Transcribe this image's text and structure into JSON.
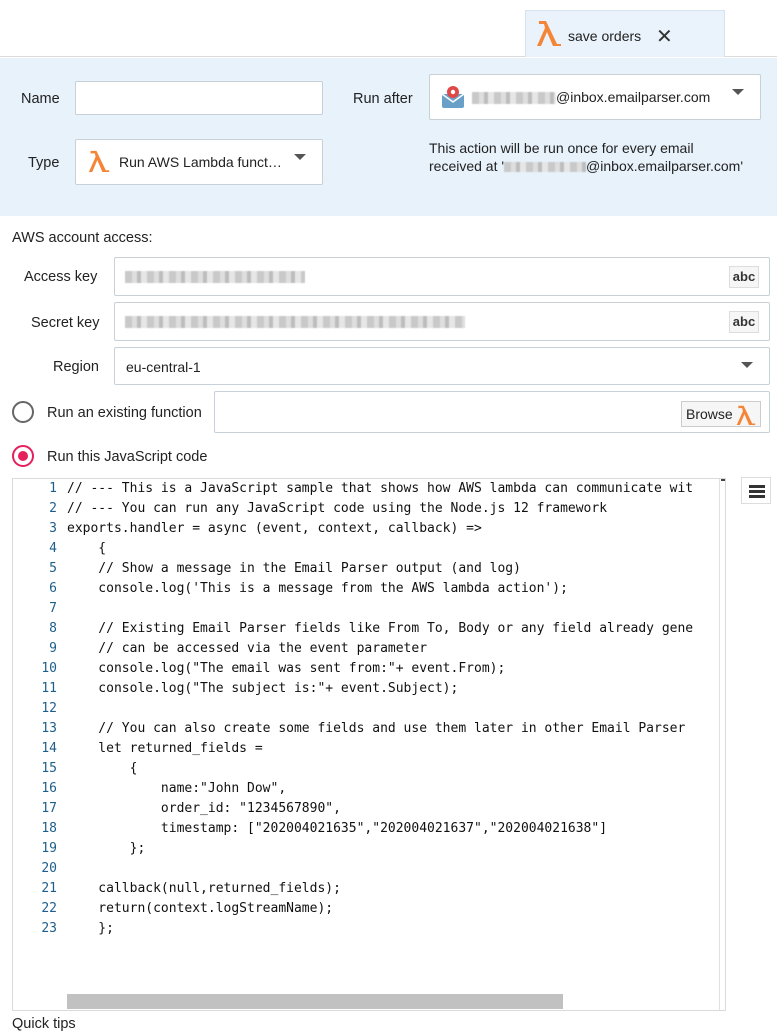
{
  "tab": {
    "title": "save orders",
    "close_icon": "close-icon"
  },
  "form": {
    "name_label": "Name",
    "name_value": "",
    "type_label": "Type",
    "type_value": "Run AWS Lambda funct…",
    "run_after_label": "Run after",
    "run_after_email": "@inbox.emailparser.com",
    "info_line1": "This action will be run once for every email",
    "info_line2_prefix": "received at '",
    "info_line2_suffix": "@inbox.emailparser.com'"
  },
  "aws": {
    "section_title": "AWS account access:",
    "access_key_label": "Access key",
    "secret_key_label": "Secret key",
    "region_label": "Region",
    "region_value": "eu-central-1",
    "abc_label": "abc"
  },
  "options": {
    "existing_function_label": "Run an existing function",
    "browse_label": "Browse",
    "run_code_label": "Run this JavaScript code",
    "selected": "run_code"
  },
  "code_lines": [
    "// --- This is a JavaScript sample that shows how AWS lambda can communicate wit",
    "// --- You can run any JavaScript code using the Node.js 12 framework",
    "exports.handler = async (event, context, callback) =>",
    "    {",
    "    // Show a message in the Email Parser output (and log)",
    "    console.log('This is a message from the AWS lambda action');",
    "",
    "    // Existing Email Parser fields like From To, Body or any field already gene",
    "    // can be accessed via the event parameter",
    "    console.log(\"The email was sent from:\"+ event.From);",
    "    console.log(\"The subject is:\"+ event.Subject);",
    "",
    "    // You can also create some fields and use them later in other Email Parser",
    "    let returned_fields =",
    "        {",
    "            name:\"John Dow\",",
    "            order_id: \"1234567890\",",
    "            timestamp: [\"202004021635\",\"202004021637\",\"202004021638\"]",
    "        };",
    "",
    "    callback(null,returned_fields);",
    "    return(context.logStreamName);",
    "    };"
  ],
  "bottom_label": "Quick tips",
  "colors": {
    "accent": "#e5205d",
    "lambda": "#f58536",
    "panel": "#e8f2fb"
  }
}
